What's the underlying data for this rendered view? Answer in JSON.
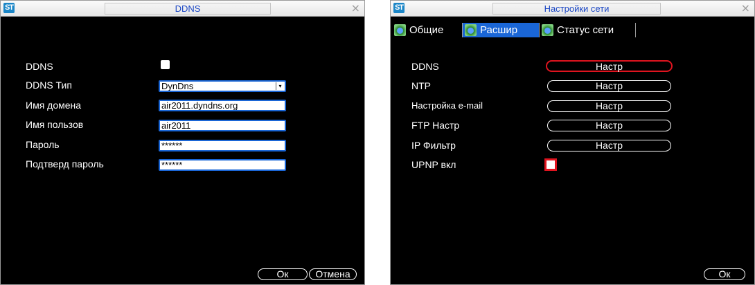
{
  "ddns_window": {
    "logo": "ST",
    "title": "DDNS",
    "close_glyph": "×",
    "rows": {
      "ddns_label": "DDNS",
      "type_label": "DDNS Тип",
      "type_value": "DynDns",
      "domain_label": "Имя домена",
      "domain_value": "air2011.dyndns.org",
      "user_label": "Имя пользов",
      "user_value": "air2011",
      "password_label": "Пароль",
      "password_value": "******",
      "confirm_label": "Подтверд пароль",
      "confirm_value": "******"
    },
    "ddns_checked": false,
    "ok_label": "Ок",
    "cancel_label": "Отмена"
  },
  "network_window": {
    "logo": "ST",
    "title": "Настройки сети",
    "close_glyph": "×",
    "tabs": [
      {
        "label": "Общие",
        "active": false
      },
      {
        "label": "Расшир",
        "active": true
      },
      {
        "label": "Статус сети",
        "active": false
      }
    ],
    "rows": [
      {
        "label": "DDNS",
        "button": "Настр"
      },
      {
        "label": "NTP",
        "button": "Настр"
      },
      {
        "label": "Настройка e-mail",
        "button": "Настр"
      },
      {
        "label": "FTP Настр",
        "button": "Настр"
      },
      {
        "label": "IP Фильтр",
        "button": "Настр"
      }
    ],
    "upnp_label": "UPNP вкл",
    "upnp_checked": false,
    "ok_label": "Ок"
  },
  "colors": {
    "accent": "#1a66d6",
    "title_text": "#1a46c4",
    "selection": "#e0141f",
    "background": "#000000",
    "text": "#ffffff"
  }
}
